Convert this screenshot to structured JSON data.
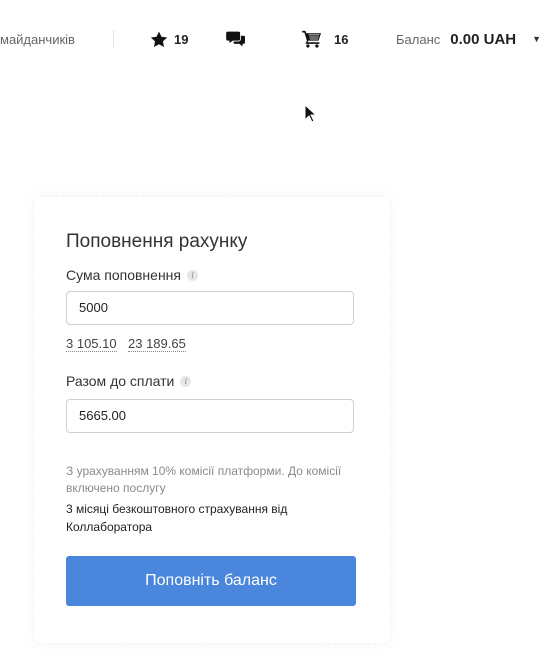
{
  "header": {
    "marketplaces_link": "майданчиків",
    "favorites_count": "19",
    "cart_count": "16",
    "balance_label": "Баланс",
    "balance_value": "0.00 UAH"
  },
  "form": {
    "title": "Поповнення рахунку",
    "amount_label": "Сума поповнення",
    "amount_value": "5000",
    "conversion_1": "3 105.10",
    "conversion_2": "23 189.65",
    "total_label": "Разом до сплати",
    "total_value": "5665.00",
    "commission_note": "З урахуванням 10% комісії платформи. До комісії включено послугу",
    "insurance_note": "3 місяці безкоштовного страхування від Коллаборатора",
    "submit_label": "Поповніть баланс"
  },
  "colors": {
    "accent": "#4a87dc",
    "muted_text": "#8a8a8a"
  },
  "icons": {
    "favorites": "star-icon",
    "messages": "chat-bubbles-icon",
    "cart": "cart-icon",
    "info": "info-icon"
  }
}
